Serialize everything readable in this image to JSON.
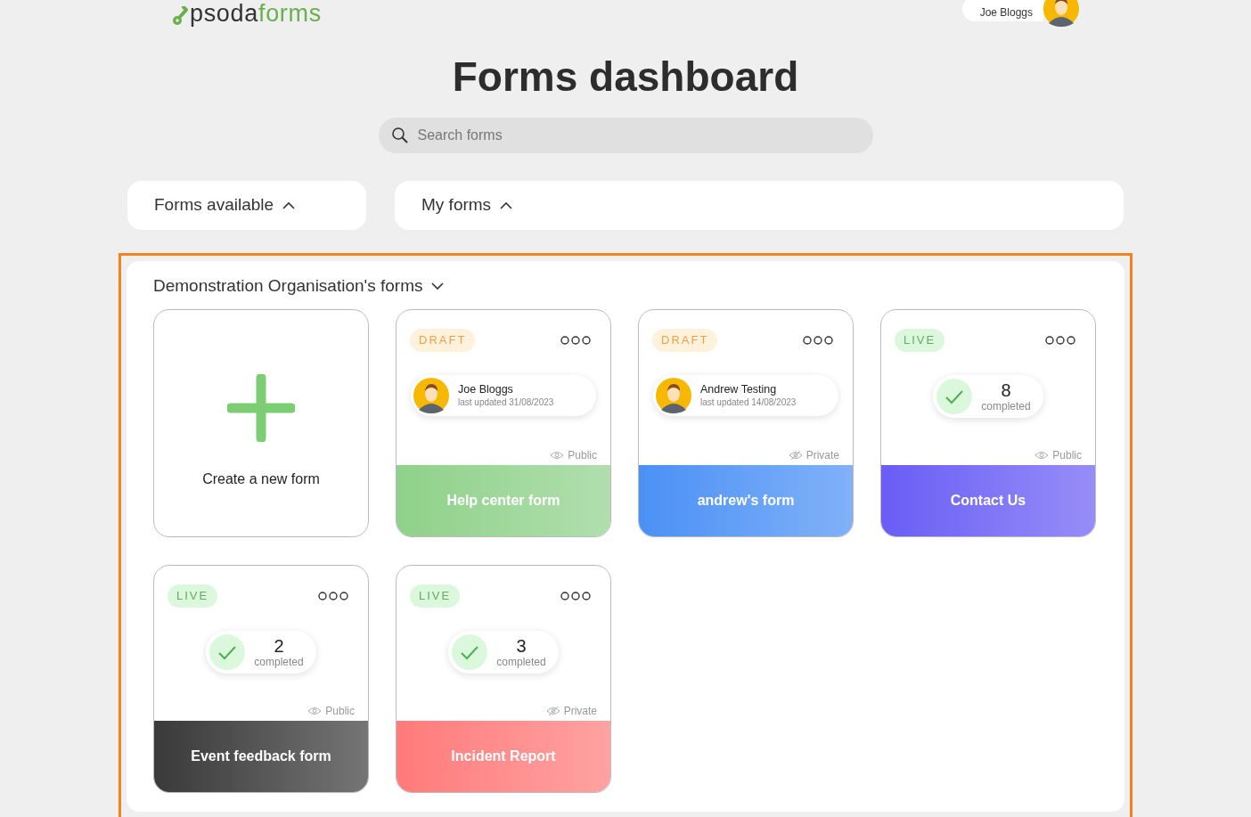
{
  "header": {
    "logo": {
      "name": "psoda",
      "product": "forms"
    },
    "user": {
      "name": "Joe Bloggs"
    }
  },
  "title": "Forms dashboard",
  "search": {
    "placeholder": "Search forms"
  },
  "filters": [
    {
      "label": "Forms available",
      "expanded": true
    },
    {
      "label": "My forms",
      "expanded": true
    }
  ],
  "section": {
    "title": "Demonstration Organisation's forms",
    "expanded": false,
    "highlighted": true,
    "create_card": {
      "label": "Create a new form"
    },
    "forms": [
      {
        "status": "DRAFT",
        "kind": "owner",
        "owner": "Joe Bloggs",
        "updated": "last updated 31/08/2023",
        "visibility": "Public",
        "name": "Help center form",
        "color": "#8fd18a"
      },
      {
        "status": "DRAFT",
        "kind": "owner",
        "owner": "Andrew Testing",
        "updated": "last updated 14/08/2023",
        "visibility": "Private",
        "name": "andrew's form",
        "color": "#4a90f5"
      },
      {
        "status": "LIVE",
        "kind": "completed",
        "count": "8",
        "count_label": "completed",
        "visibility": "Public",
        "name": "Contact Us",
        "color": "#6a5cf5"
      },
      {
        "status": "LIVE",
        "kind": "completed",
        "count": "2",
        "count_label": "completed",
        "visibility": "Public",
        "name": "Event feedback form",
        "color": "#3a3a3a"
      },
      {
        "status": "LIVE",
        "kind": "completed",
        "count": "3",
        "count_label": "completed",
        "visibility": "Private",
        "name": "Incident Report",
        "color": "#ff7a7a"
      }
    ]
  }
}
